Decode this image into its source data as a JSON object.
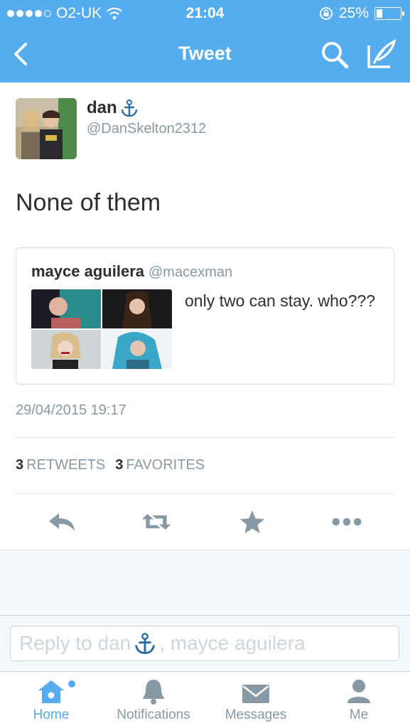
{
  "status_bar": {
    "carrier": "O2-UK",
    "time": "21:04",
    "battery": "25%",
    "battery_level": 0.25
  },
  "nav": {
    "title": "Tweet",
    "icons": [
      "back-arrow-icon",
      "search-icon",
      "compose-icon"
    ]
  },
  "tweet": {
    "username": "dan",
    "handle": "@DanSkelton2312",
    "text": "None of them",
    "timestamp": "29/04/2015 19:17",
    "retweets_count": "3",
    "retweets_label": "RETWEETS",
    "favorites_count": "3",
    "favorites_label": "FAVORITES"
  },
  "quoted_tweet": {
    "name": "mayce aguilera",
    "handle": "@macexman",
    "text": "only two can stay. who???"
  },
  "reply": {
    "text_before": "Reply to dan",
    "text_after": ", mayce aguilera"
  },
  "tabs": [
    {
      "label": "Home",
      "active": true
    },
    {
      "label": "Notifications",
      "active": false
    },
    {
      "label": "Messages",
      "active": false
    },
    {
      "label": "Me",
      "active": false
    }
  ],
  "colors": {
    "accent": "#55acee",
    "muted": "#8899a6",
    "text": "#292f33",
    "action_icon": "#8899a6"
  }
}
